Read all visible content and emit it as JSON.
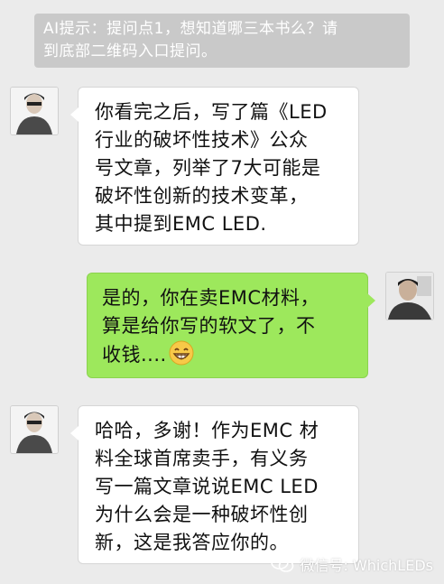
{
  "notice": {
    "line1": "AI提示：提问点1，想知道哪三本书么？请",
    "line2": "到底部二维码入口提问。"
  },
  "messages": [
    {
      "side": "left",
      "lines": [
        "你看完之后，写了篇《LED",
        "行业的破坏性技术》公众",
        "号文章，列举了7大可能是",
        "破坏性创新的技术变革，",
        "其中提到EMC LED."
      ]
    },
    {
      "side": "right",
      "lines": [
        "是的，你在卖EMC材料，",
        "算是给你写的软文了，不",
        "收钱...."
      ],
      "emoji": "grin-emoji"
    },
    {
      "side": "left",
      "lines": [
        "哈哈，多谢！作为EMC 材",
        "料全球首席卖手，有义务",
        "写一篇文章说说EMC LED",
        "为什么会是一种破坏性创",
        "新，这是我答应你的。"
      ]
    }
  ],
  "watermark": {
    "text": "微信号: WhichLEDs",
    "icon": "wechat-icon"
  },
  "colors": {
    "background": "#ebebeb",
    "notice_bg": "#c9c9c9",
    "bubble_left": "#ffffff",
    "bubble_right": "#9de85c"
  }
}
